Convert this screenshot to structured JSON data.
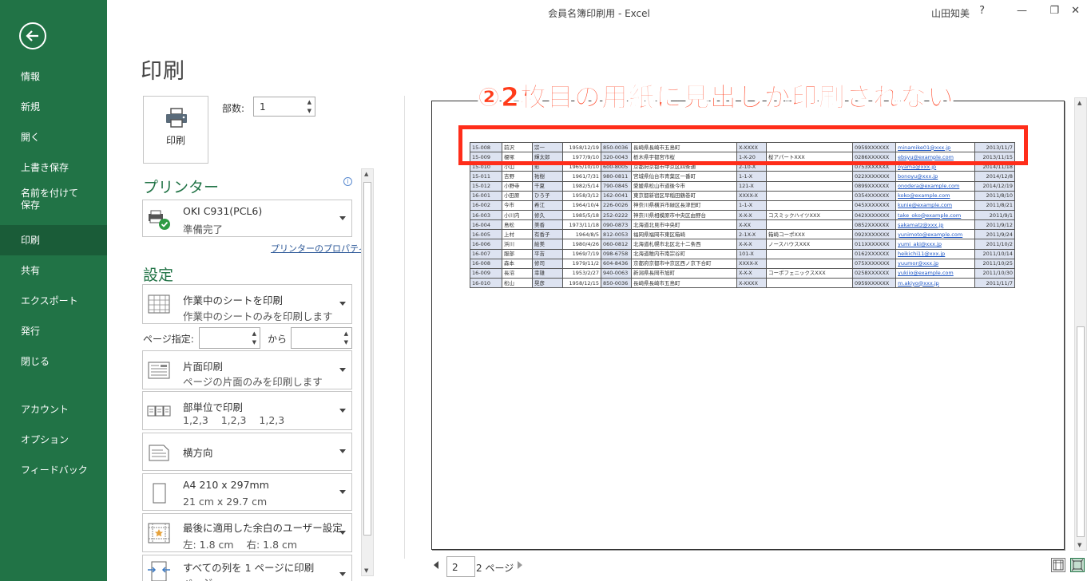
{
  "window": {
    "title": "会員名簿印刷用 - Excel",
    "user": "山田知美",
    "help": "?",
    "minimize": "—",
    "restore": "❐",
    "close": "✕"
  },
  "sidebar": {
    "items": [
      {
        "label": "情報"
      },
      {
        "label": "新規"
      },
      {
        "label": "開く"
      },
      {
        "label": "上書き保存"
      },
      {
        "label": "名前を付けて\n保存"
      },
      {
        "label": "印刷",
        "active": true
      },
      {
        "label": "共有"
      },
      {
        "label": "エクスポート"
      },
      {
        "label": "発行"
      },
      {
        "label": "閉じる"
      },
      {
        "label": "アカウント"
      },
      {
        "label": "オプション"
      },
      {
        "label": "フィードバック"
      }
    ]
  },
  "print": {
    "heading": "印刷",
    "print_button": "印刷",
    "copies_label": "部数:",
    "copies_value": "1",
    "printer_heading": "プリンター",
    "printer_name": "OKI C931(PCL6)",
    "printer_status": "準備完了",
    "printer_properties": "プリンターのプロパティ",
    "settings_heading": "設定",
    "what_title": "作業中のシートを印刷",
    "what_desc": "作業中のシートのみを印刷します",
    "pages_label": "ページ指定:",
    "pages_to": "から",
    "sides_title": "片面印刷",
    "sides_desc": "ページの片面のみを印刷します",
    "collate_title": "部単位で印刷",
    "collate_desc": "1,2,3    1,2,3    1,2,3",
    "orientation": "横方向",
    "paper_title": "A4 210 x 297mm",
    "paper_desc": "21 cm x 29.7 cm",
    "margins_title": "最後に適用した余白のユーザー設定",
    "margins_desc": "左: 1.8 cm    右: 1.8 cm",
    "scaling_title": "すべての列を 1 ページに印刷",
    "scaling_desc": "ページ"
  },
  "preview": {
    "annotation": "②2枚目の用紙に見出しが印刷されない",
    "page_current": "2",
    "page_total": "2 ページ",
    "rows": [
      [
        "15-008",
        "前沢",
        "宗一",
        "1958/12/19",
        "850-0036",
        "長崎県長崎市五島町",
        "X-XXXX",
        "",
        "0959XXXXXX",
        "minamike01@xxx.jp",
        "2013/11/7"
      ],
      [
        "15-009",
        "榎塚",
        "輝太郎",
        "1977/9/10",
        "320-0043",
        "栃木県宇都宮市桜",
        "1-X-20",
        "桜アパートXXX",
        "0286XXXXXX",
        "ebsyu@example.com",
        "2013/11/15"
      ],
      [
        "15-010",
        "小山",
        "彩",
        "1965/10/10",
        "600-8005",
        "京都府京都市中京区四条通",
        "2-10-X",
        "",
        "0753XXXXXX",
        "oyama@xxx.jp",
        "2014/11/18"
      ],
      [
        "15-011",
        "吉野",
        "祐樹",
        "1961/7/31",
        "980-0811",
        "宮城県仙台市青葉区一番町",
        "1-1-X",
        "",
        "022XXXXXXX",
        "bonoyu@xxx.jp",
        "2014/12/8"
      ],
      [
        "15-012",
        "小野寺",
        "千夏",
        "1982/5/14",
        "790-0845",
        "愛媛県松山市道後今市",
        "121-X",
        "",
        "0899XXXXXX",
        "onodera@example.com",
        "2014/12/19"
      ],
      [
        "16-001",
        "小田原",
        "ひろ子",
        "1958/3/12",
        "162-0041",
        "東京都新宿区早稲田鶴巻町",
        "XXXX-X",
        "",
        "0354XXXXXX",
        "koko@example.com",
        "2011/8/10"
      ],
      [
        "16-002",
        "今市",
        "希江",
        "1964/10/4",
        "226-0026",
        "神奈川県横浜市緑区長津田町",
        "1-1-X",
        "",
        "045XXXXXXX",
        "kunie@example.com",
        "2011/8/21"
      ],
      [
        "16-003",
        "小川内",
        "修久",
        "1985/5/18",
        "252-0222",
        "神奈川県相模原市中央区由野台",
        "X-X-X",
        "コスミックハイツXXX",
        "042XXXXXXX",
        "take_oko@example.com",
        "2011/9/1"
      ],
      [
        "16-004",
        "島松",
        "美香",
        "1973/11/18",
        "090-0873",
        "北海道北見市中央町",
        "X-XX",
        "",
        "0852XXXXXX",
        "sakamatz@xxx.jp",
        "2011/9/12"
      ],
      [
        "16-005",
        "上村",
        "有香子",
        "1964/8/5",
        "812-0053",
        "福岡県福岡市東区箱崎",
        "2-1X-X",
        "箱崎コーポXXX",
        "092XXXXXXX",
        "yunimoto@example.com",
        "2011/9/24"
      ],
      [
        "16-006",
        "浜川",
        "絵美",
        "1980/4/26",
        "060-0812",
        "北海道札幌市北区北十二条西",
        "X-X-X",
        "ノースハウスXXX",
        "011XXXXXXX",
        "yumi_aki@xxx.jp",
        "2011/10/2"
      ],
      [
        "16-007",
        "服部",
        "平吉",
        "1969/7/19",
        "098-6758",
        "北海道稚内市南宗谷町",
        "101-X",
        "",
        "0162XXXXXX",
        "heikichi11@xxx.jp",
        "2011/10/14"
      ],
      [
        "16-008",
        "森本",
        "修司",
        "1979/11/2",
        "604-8436",
        "京都府京都市中京区西ノ京下合町",
        "XXXX-X",
        "",
        "075XXXXXXX",
        "yuumor@xxx.jp",
        "2011/10/25"
      ],
      [
        "16-009",
        "長沼",
        "幸雄",
        "1953/2/27",
        "940-0063",
        "新潟県長岡市旭町",
        "X-X-X",
        "コーポフェニックスXXX",
        "0258XXXXXX",
        "yukiio@example.com",
        "2011/10/30"
      ],
      [
        "16-010",
        "松山",
        "晃彦",
        "1958/12/15",
        "850-0036",
        "長崎県長崎市五島町",
        "X-XXXX",
        "",
        "0959XXXXXX",
        "m.akiyo@xxx.jp",
        "2011/11/7"
      ]
    ]
  },
  "colors": {
    "sidebar": "#217346",
    "sidebar_active": "#1a5c38",
    "accent_green": "#217346",
    "annotation_red": "#ff2d1a",
    "row_shade": "#dde3f1"
  },
  "icons": [
    "back-arrow-icon",
    "printer-icon",
    "info-icon",
    "sheets-icon",
    "one-sided-icon",
    "collate-icon",
    "landscape-icon",
    "paper-icon",
    "margins-icon",
    "scaling-icon"
  ]
}
